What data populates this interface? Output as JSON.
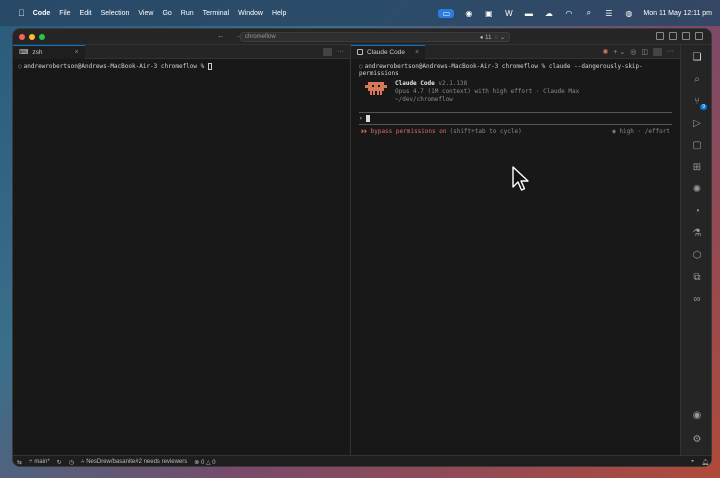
{
  "menubar": {
    "app_name": "Code",
    "items": [
      "File",
      "Edit",
      "Selection",
      "View",
      "Go",
      "Run",
      "Terminal",
      "Window",
      "Help"
    ],
    "clock": "Mon 11 May  12:11 pm"
  },
  "titlebar": {
    "search_text": "chromeflow",
    "badge_count": "11"
  },
  "left_pane": {
    "tab_label": "zsh",
    "prompt": "andrewrobertson@Andrews-MacBook-Air-3 chromeflow % "
  },
  "right_pane": {
    "tab_label": "Claude Code",
    "command": "andrewrobertson@Andrews-MacBook-Air-3 chromeflow % claude --dangerously-skip-permissions",
    "claude_name": "Claude Code",
    "claude_version": "v2.1.138",
    "model_line": "Opus 4.7 (1M context) with high effort · Claude Max",
    "path_line": "~/dev/chromeflow",
    "input_prompt": "›",
    "bypass_text": "⏵⏵ bypass permissions on",
    "bypass_hint": "(shift+tab to cycle)",
    "effort_text": "◉ high · /effort"
  },
  "activitybar": {
    "scm_badge": "9"
  },
  "statusbar": {
    "branch": "main*",
    "pr_text": "NesDrew/basanite#2 needs reviewers",
    "errors": "0",
    "warnings": "0"
  },
  "colors": {
    "accent": "#0078d4",
    "bypass": "#e06c6c",
    "claude_logo": "#d9775a"
  }
}
